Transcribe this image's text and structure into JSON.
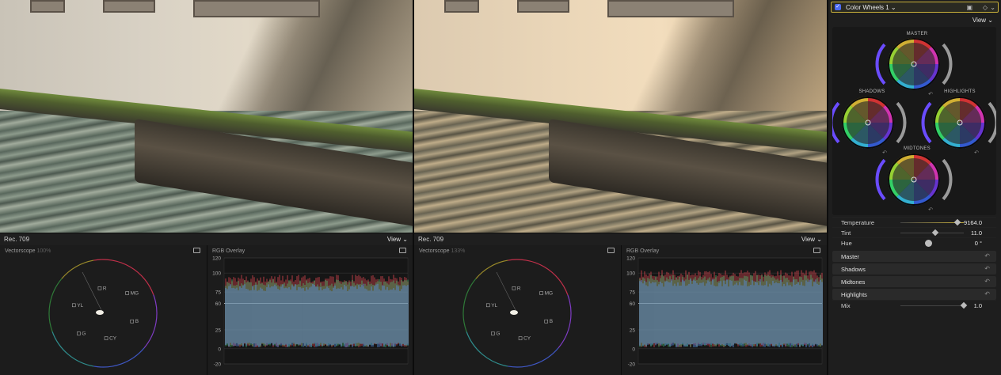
{
  "viewers": {
    "left": {
      "scope_format": "Rec. 709",
      "view_label": "View ⌄"
    },
    "right": {
      "scope_format": "Rec. 709",
      "view_label": "View ⌄"
    }
  },
  "scopes": {
    "vectorscope_left": {
      "title": "Vectorscope",
      "pct": "100%"
    },
    "rgb_left": {
      "title": "RGB Overlay"
    },
    "vectorscope_right": {
      "title": "Vectorscope",
      "pct": "133%"
    },
    "rgb_right": {
      "title": "RGB Overlay"
    },
    "vector_targets": [
      "R",
      "MG",
      "B",
      "CY",
      "G",
      "YL"
    ],
    "rgb_scale": [
      "120",
      "100",
      "75",
      "60",
      "25",
      "0",
      "-20"
    ]
  },
  "inspector": {
    "effect_name": "Color Wheels 1 ⌄",
    "view_label": "View ⌄",
    "wheels": {
      "master": "MASTER",
      "shadows": "SHADOWS",
      "highlights": "HIGHLIGHTS",
      "midtones": "MIDTONES"
    },
    "params": [
      {
        "label": "Temperature",
        "value": "9164.0",
        "level": 0.9
      },
      {
        "label": "Tint",
        "value": "11.0",
        "level": 0.55
      },
      {
        "label": "Hue",
        "value": "0 °"
      }
    ],
    "sections": [
      "Master",
      "Shadows",
      "Midtones",
      "Highlights"
    ],
    "mix": {
      "label": "Mix",
      "value": "1.0",
      "level": 1.0
    },
    "colors": {
      "accent": "#c9b13a",
      "checkbox": "#4d6cf2"
    }
  }
}
